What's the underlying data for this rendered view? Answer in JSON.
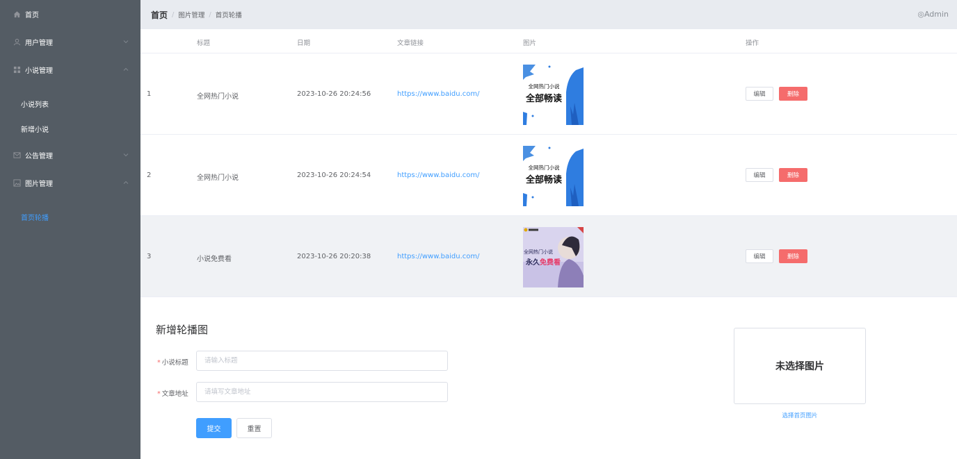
{
  "sidebar": {
    "home": "首页",
    "user_mgmt": "用户管理",
    "novel_mgmt": "小说管理",
    "novel_list": "小说列表",
    "novel_add": "新增小说",
    "notice_mgmt": "公告管理",
    "image_mgmt": "图片管理",
    "home_carousel": "首页轮播",
    "bg_color": "#545c64",
    "active_color": "#409eff"
  },
  "header": {
    "crumb_home": "首页",
    "crumb_sep": "/",
    "crumb_image_mgmt": "图片管理",
    "crumb_carousel": "首页轮播",
    "user": "◎Admin"
  },
  "table": {
    "headers": {
      "title": "标题",
      "date": "日期",
      "link": "文章链接",
      "image": "图片",
      "actions": "操作"
    },
    "rows": [
      {
        "index": "1",
        "title": "全网热门小说",
        "date": "2023-10-26 20:24:56",
        "link": "https://www.baidu.com/",
        "img_line1": "全网热门小说",
        "img_line2": "全部畅读"
      },
      {
        "index": "2",
        "title": "全网热门小说",
        "date": "2023-10-26 20:24:54",
        "link": "https://www.baidu.com/",
        "img_line1": "全网热门小说",
        "img_line2": "全部畅读"
      },
      {
        "index": "3",
        "title": "小说免费看",
        "date": "2023-10-26 20:20:38",
        "link": "https://www.baidu.com/",
        "img_line1": "全网热门小说",
        "img_line2a": "永久",
        "img_line2b": "免费看"
      }
    ],
    "edit_label": "编辑",
    "delete_label": "删除"
  },
  "form": {
    "title": "新增轮播图",
    "required_mark": "*",
    "title_label": "小说标题",
    "title_placeholder": "请输入标题",
    "url_label": "文章地址",
    "url_placeholder": "请填写文章地址",
    "submit": "提交",
    "reset": "重置",
    "upload_empty": "未选择图片",
    "upload_link": "选择首页图片"
  }
}
